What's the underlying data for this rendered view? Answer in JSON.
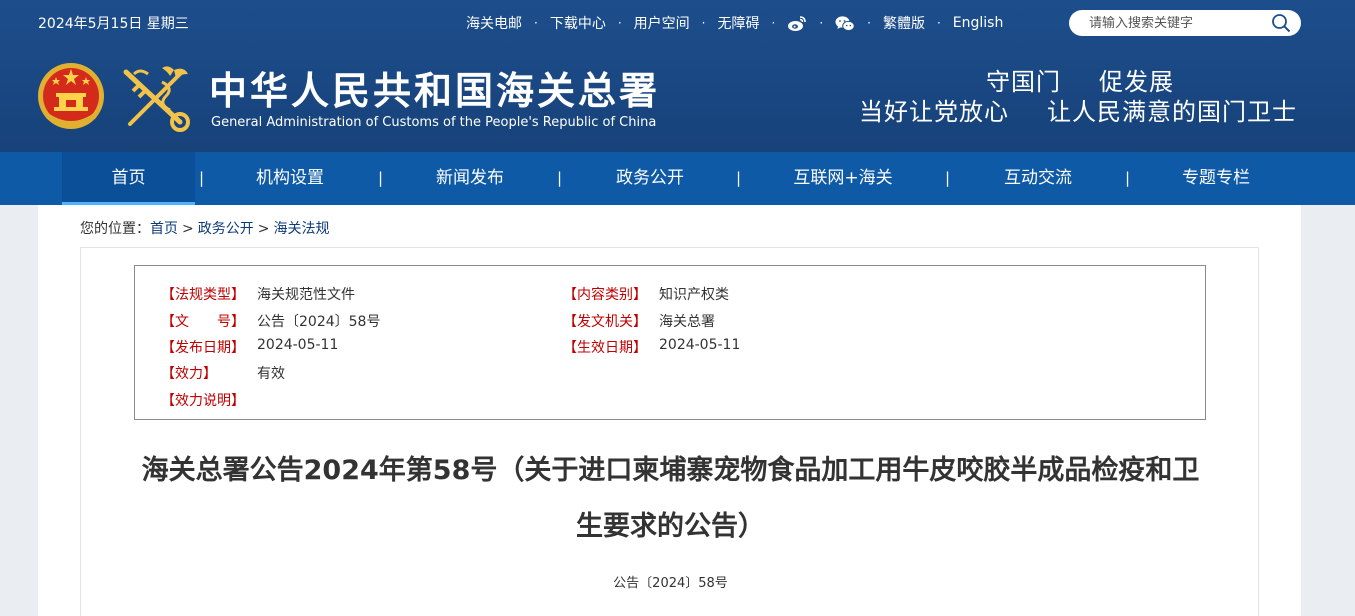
{
  "header": {
    "date": "2024年5月15日 星期三",
    "links": [
      "海关电邮",
      "下载中心",
      "用户空间",
      "无障碍"
    ],
    "icons": [
      "weibo-icon",
      "wechat-icon"
    ],
    "lang_links": [
      "繁體版",
      "English"
    ],
    "search_placeholder": "请输入搜索关键字",
    "title_cn": "中华人民共和国海关总署",
    "title_en": "General Administration of Customs of the People's Republic of China",
    "slogan_line1": [
      "守国门",
      "促发展"
    ],
    "slogan_line2": [
      "当好让党放心",
      "让人民满意的国门卫士"
    ]
  },
  "nav": {
    "items": [
      "首页",
      "机构设置",
      "新闻发布",
      "政务公开",
      "互联网+海关",
      "互动交流",
      "专题专栏"
    ],
    "separator": "|",
    "active_index": 0
  },
  "breadcrumb": {
    "prefix": "您的位置：",
    "items": [
      "首页",
      "政务公开",
      "海关法规"
    ],
    "separator": ">"
  },
  "info": {
    "type_label": "【法规类型】",
    "type_value": "海关规范性文件",
    "category_label": "【内容类别】",
    "category_value": "知识产权类",
    "docno_label": "【文　　号】",
    "docno_value": "公告〔2024〕58号",
    "issuer_label": "【发文机关】",
    "issuer_value": "海关总署",
    "pubdate_label": "【发布日期】",
    "pubdate_value": "2024-05-11",
    "effdate_label": "【生效日期】",
    "effdate_value": "2024-05-11",
    "validity_label": "【效力】",
    "validity_value": "有效",
    "validity_note_label": "【效力说明】",
    "validity_note_value": ""
  },
  "article": {
    "title": "海关总署公告2024年第58号（关于进口柬埔寨宠物食品加工用牛皮咬胶半成品检疫和卫生要求的公告）",
    "doc_no": "公告〔2024〕58号"
  },
  "colors": {
    "header_bg": "#1d4e8c",
    "nav_bg": "#0e5aa7",
    "label_red": "#c00000"
  }
}
